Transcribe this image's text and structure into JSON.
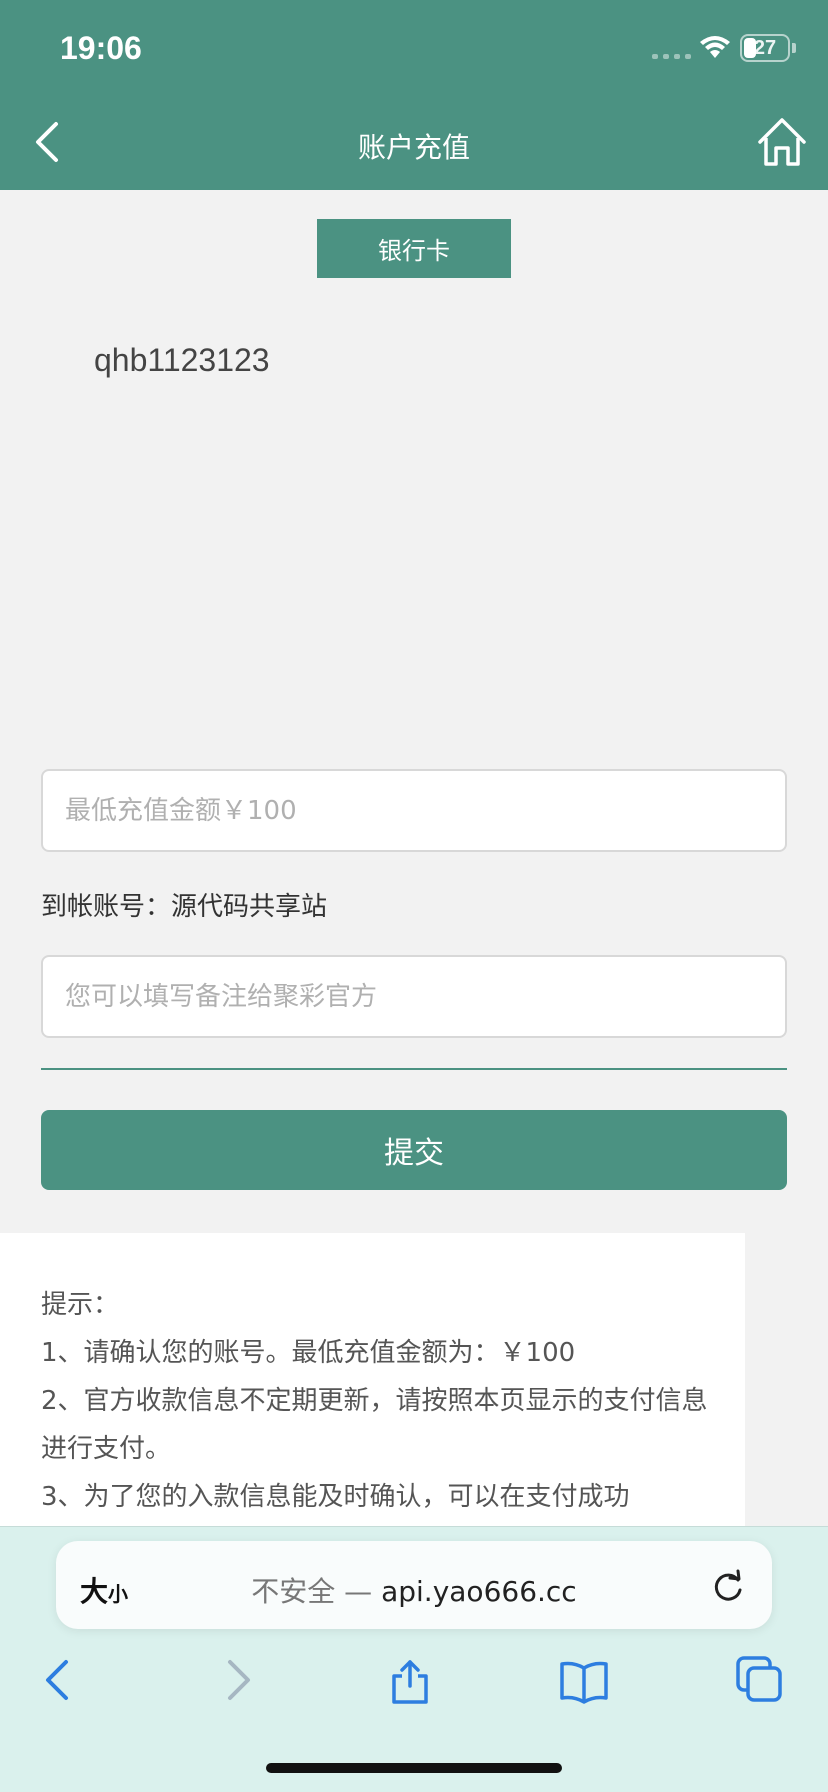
{
  "status_bar": {
    "time": "19:06",
    "battery": "27"
  },
  "nav": {
    "title": "账户充值"
  },
  "tabs": [
    {
      "label": "银行卡"
    }
  ],
  "account": {
    "id": "qhb1123123"
  },
  "form": {
    "amount_placeholder": "最低充值金额￥100",
    "receive_label": "到帐账号：",
    "receive_value": "源代码共享站",
    "remark_placeholder": "您可以填写备注给聚彩官方",
    "submit_label": "提交"
  },
  "tips": {
    "title": "提示：",
    "items": [
      "1、请确认您的账号。最低充值金额为：￥100",
      "2、官方收款信息不定期更新，请按照本页显示的支付信息进行支付。",
      "3、为了您的入款信息能及时确认，可以在支付成功"
    ]
  },
  "browser": {
    "aa_label": "大",
    "aa_small": "小",
    "insecure": "不安全 — ",
    "domain": "api.yao666.cc"
  },
  "colors": {
    "primary": "#4b9282",
    "browser_bar": "#daf1ed"
  },
  "icons": [
    "back-chevron",
    "home-icon",
    "wifi-icon",
    "battery-icon",
    "reload-icon",
    "safari-back",
    "safari-forward",
    "share-icon",
    "bookmarks-icon",
    "tabs-icon"
  ]
}
